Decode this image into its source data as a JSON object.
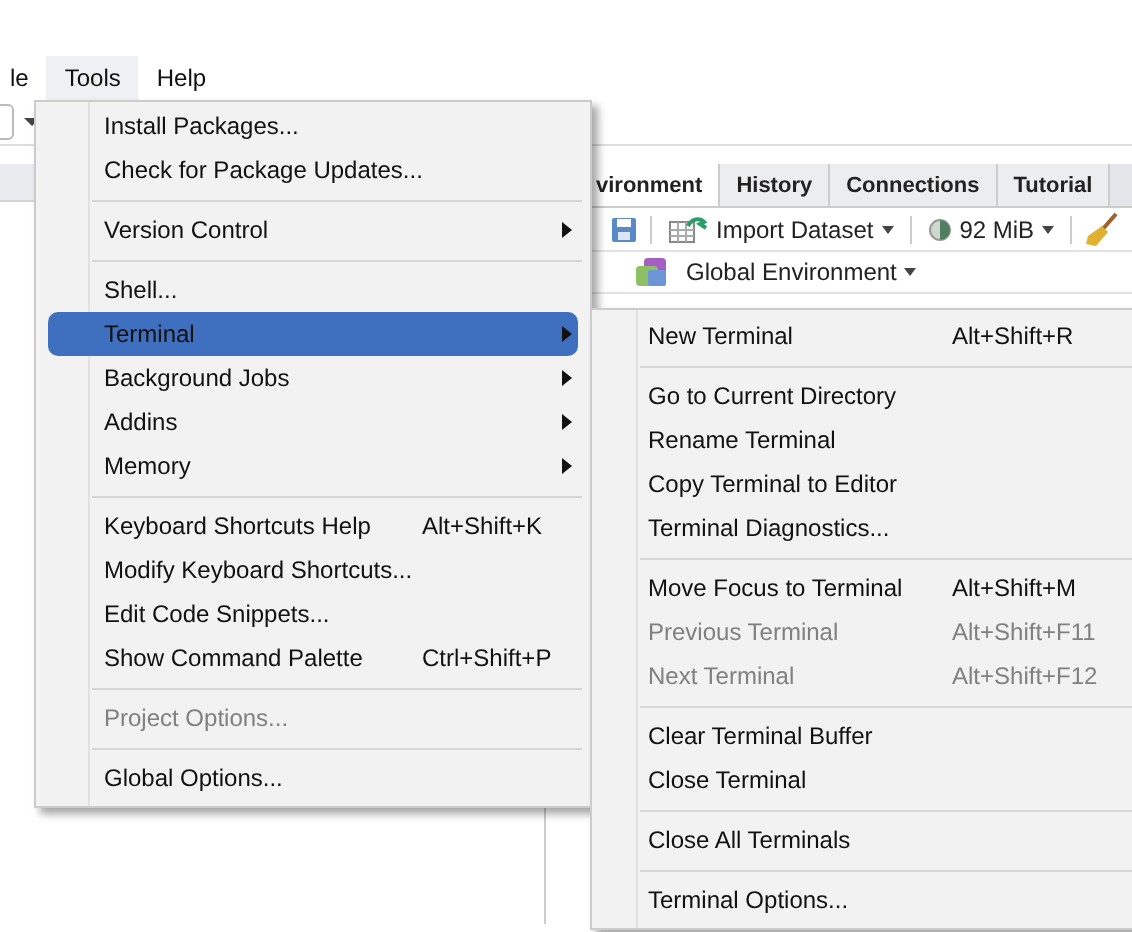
{
  "menubar": [
    {
      "label": "le",
      "selected": false
    },
    {
      "label": "Tools",
      "selected": true
    },
    {
      "label": "Help",
      "selected": false
    }
  ],
  "environment_pane": {
    "tabs": [
      {
        "label": "vironment",
        "selected": true
      },
      {
        "label": "History",
        "selected": false
      },
      {
        "label": "Connections",
        "selected": false
      },
      {
        "label": "Tutorial",
        "selected": false
      }
    ],
    "import_button": "Import Dataset",
    "memory_button": "92 MiB",
    "environment_selector": "Global Environment"
  },
  "tools_menu": {
    "items": [
      {
        "kind": "item",
        "label": "Install Packages...",
        "disabled": false,
        "submenu": false,
        "selected": false
      },
      {
        "kind": "item",
        "label": "Check for Package Updates...",
        "disabled": false,
        "submenu": false,
        "selected": false
      },
      {
        "kind": "separator"
      },
      {
        "kind": "item",
        "label": "Version Control",
        "disabled": false,
        "submenu": true,
        "selected": false
      },
      {
        "kind": "separator"
      },
      {
        "kind": "item",
        "label": "Shell...",
        "disabled": false,
        "submenu": false,
        "selected": false
      },
      {
        "kind": "item",
        "label": "Terminal",
        "disabled": false,
        "submenu": true,
        "selected": true
      },
      {
        "kind": "item",
        "label": "Background Jobs",
        "disabled": false,
        "submenu": true,
        "selected": false
      },
      {
        "kind": "item",
        "label": "Addins",
        "disabled": false,
        "submenu": true,
        "selected": false
      },
      {
        "kind": "item",
        "label": "Memory",
        "disabled": false,
        "submenu": true,
        "selected": false
      },
      {
        "kind": "separator"
      },
      {
        "kind": "item",
        "label": "Keyboard Shortcuts Help",
        "shortcut": "Alt+Shift+K",
        "disabled": false,
        "submenu": false,
        "selected": false
      },
      {
        "kind": "item",
        "label": "Modify Keyboard Shortcuts...",
        "disabled": false,
        "submenu": false,
        "selected": false
      },
      {
        "kind": "item",
        "label": "Edit Code Snippets...",
        "disabled": false,
        "submenu": false,
        "selected": false
      },
      {
        "kind": "item",
        "label": "Show Command Palette",
        "shortcut": "Ctrl+Shift+P",
        "disabled": false,
        "submenu": false,
        "selected": false
      },
      {
        "kind": "separator"
      },
      {
        "kind": "item",
        "label": "Project Options...",
        "disabled": true,
        "submenu": false,
        "selected": false
      },
      {
        "kind": "separator"
      },
      {
        "kind": "item",
        "label": "Global Options...",
        "disabled": false,
        "submenu": false,
        "selected": false
      }
    ]
  },
  "terminal_menu": {
    "items": [
      {
        "kind": "item",
        "label": "New Terminal",
        "shortcut": "Alt+Shift+R",
        "disabled": false,
        "selected": false
      },
      {
        "kind": "separator"
      },
      {
        "kind": "item",
        "label": "Go to Current Directory",
        "disabled": false,
        "selected": false
      },
      {
        "kind": "item",
        "label": "Rename Terminal",
        "disabled": false,
        "selected": false
      },
      {
        "kind": "item",
        "label": "Copy Terminal to Editor",
        "disabled": false,
        "selected": false
      },
      {
        "kind": "item",
        "label": "Terminal Diagnostics...",
        "disabled": false,
        "selected": false
      },
      {
        "kind": "separator"
      },
      {
        "kind": "item",
        "label": "Move Focus to Terminal",
        "shortcut": "Alt+Shift+M",
        "disabled": false,
        "selected": false
      },
      {
        "kind": "item",
        "label": "Previous Terminal",
        "shortcut": "Alt+Shift+F11",
        "disabled": true,
        "selected": false
      },
      {
        "kind": "item",
        "label": "Next Terminal",
        "shortcut": "Alt+Shift+F12",
        "disabled": true,
        "selected": false
      },
      {
        "kind": "separator"
      },
      {
        "kind": "item",
        "label": "Clear Terminal Buffer",
        "disabled": false,
        "selected": false
      },
      {
        "kind": "item",
        "label": "Close Terminal",
        "disabled": false,
        "selected": false
      },
      {
        "kind": "separator"
      },
      {
        "kind": "item",
        "label": "Close All Terminals",
        "disabled": false,
        "selected": false
      },
      {
        "kind": "separator"
      },
      {
        "kind": "item",
        "label": "Terminal Options...",
        "disabled": false,
        "selected": false
      }
    ]
  }
}
